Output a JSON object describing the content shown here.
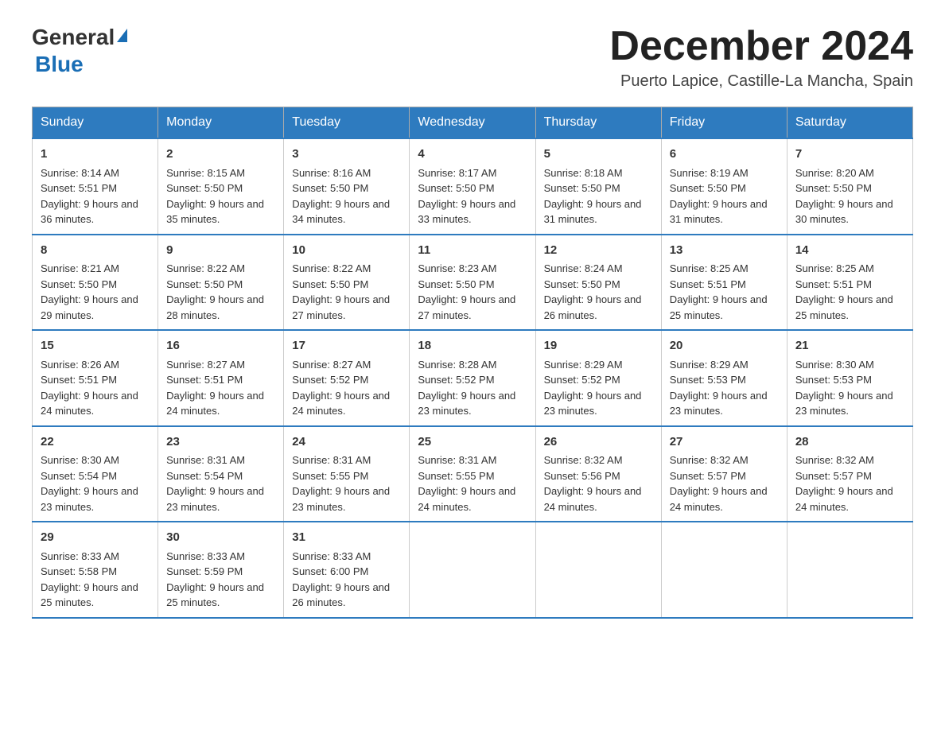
{
  "logo": {
    "general": "General",
    "blue": "Blue"
  },
  "header": {
    "month": "December 2024",
    "location": "Puerto Lapice, Castille-La Mancha, Spain"
  },
  "weekdays": [
    "Sunday",
    "Monday",
    "Tuesday",
    "Wednesday",
    "Thursday",
    "Friday",
    "Saturday"
  ],
  "weeks": [
    [
      {
        "day": "1",
        "sunrise": "8:14 AM",
        "sunset": "5:51 PM",
        "daylight": "9 hours and 36 minutes."
      },
      {
        "day": "2",
        "sunrise": "8:15 AM",
        "sunset": "5:50 PM",
        "daylight": "9 hours and 35 minutes."
      },
      {
        "day": "3",
        "sunrise": "8:16 AM",
        "sunset": "5:50 PM",
        "daylight": "9 hours and 34 minutes."
      },
      {
        "day": "4",
        "sunrise": "8:17 AM",
        "sunset": "5:50 PM",
        "daylight": "9 hours and 33 minutes."
      },
      {
        "day": "5",
        "sunrise": "8:18 AM",
        "sunset": "5:50 PM",
        "daylight": "9 hours and 31 minutes."
      },
      {
        "day": "6",
        "sunrise": "8:19 AM",
        "sunset": "5:50 PM",
        "daylight": "9 hours and 31 minutes."
      },
      {
        "day": "7",
        "sunrise": "8:20 AM",
        "sunset": "5:50 PM",
        "daylight": "9 hours and 30 minutes."
      }
    ],
    [
      {
        "day": "8",
        "sunrise": "8:21 AM",
        "sunset": "5:50 PM",
        "daylight": "9 hours and 29 minutes."
      },
      {
        "day": "9",
        "sunrise": "8:22 AM",
        "sunset": "5:50 PM",
        "daylight": "9 hours and 28 minutes."
      },
      {
        "day": "10",
        "sunrise": "8:22 AM",
        "sunset": "5:50 PM",
        "daylight": "9 hours and 27 minutes."
      },
      {
        "day": "11",
        "sunrise": "8:23 AM",
        "sunset": "5:50 PM",
        "daylight": "9 hours and 27 minutes."
      },
      {
        "day": "12",
        "sunrise": "8:24 AM",
        "sunset": "5:50 PM",
        "daylight": "9 hours and 26 minutes."
      },
      {
        "day": "13",
        "sunrise": "8:25 AM",
        "sunset": "5:51 PM",
        "daylight": "9 hours and 25 minutes."
      },
      {
        "day": "14",
        "sunrise": "8:25 AM",
        "sunset": "5:51 PM",
        "daylight": "9 hours and 25 minutes."
      }
    ],
    [
      {
        "day": "15",
        "sunrise": "8:26 AM",
        "sunset": "5:51 PM",
        "daylight": "9 hours and 24 minutes."
      },
      {
        "day": "16",
        "sunrise": "8:27 AM",
        "sunset": "5:51 PM",
        "daylight": "9 hours and 24 minutes."
      },
      {
        "day": "17",
        "sunrise": "8:27 AM",
        "sunset": "5:52 PM",
        "daylight": "9 hours and 24 minutes."
      },
      {
        "day": "18",
        "sunrise": "8:28 AM",
        "sunset": "5:52 PM",
        "daylight": "9 hours and 23 minutes."
      },
      {
        "day": "19",
        "sunrise": "8:29 AM",
        "sunset": "5:52 PM",
        "daylight": "9 hours and 23 minutes."
      },
      {
        "day": "20",
        "sunrise": "8:29 AM",
        "sunset": "5:53 PM",
        "daylight": "9 hours and 23 minutes."
      },
      {
        "day": "21",
        "sunrise": "8:30 AM",
        "sunset": "5:53 PM",
        "daylight": "9 hours and 23 minutes."
      }
    ],
    [
      {
        "day": "22",
        "sunrise": "8:30 AM",
        "sunset": "5:54 PM",
        "daylight": "9 hours and 23 minutes."
      },
      {
        "day": "23",
        "sunrise": "8:31 AM",
        "sunset": "5:54 PM",
        "daylight": "9 hours and 23 minutes."
      },
      {
        "day": "24",
        "sunrise": "8:31 AM",
        "sunset": "5:55 PM",
        "daylight": "9 hours and 23 minutes."
      },
      {
        "day": "25",
        "sunrise": "8:31 AM",
        "sunset": "5:55 PM",
        "daylight": "9 hours and 24 minutes."
      },
      {
        "day": "26",
        "sunrise": "8:32 AM",
        "sunset": "5:56 PM",
        "daylight": "9 hours and 24 minutes."
      },
      {
        "day": "27",
        "sunrise": "8:32 AM",
        "sunset": "5:57 PM",
        "daylight": "9 hours and 24 minutes."
      },
      {
        "day": "28",
        "sunrise": "8:32 AM",
        "sunset": "5:57 PM",
        "daylight": "9 hours and 24 minutes."
      }
    ],
    [
      {
        "day": "29",
        "sunrise": "8:33 AM",
        "sunset": "5:58 PM",
        "daylight": "9 hours and 25 minutes."
      },
      {
        "day": "30",
        "sunrise": "8:33 AM",
        "sunset": "5:59 PM",
        "daylight": "9 hours and 25 minutes."
      },
      {
        "day": "31",
        "sunrise": "8:33 AM",
        "sunset": "6:00 PM",
        "daylight": "9 hours and 26 minutes."
      },
      null,
      null,
      null,
      null
    ]
  ]
}
